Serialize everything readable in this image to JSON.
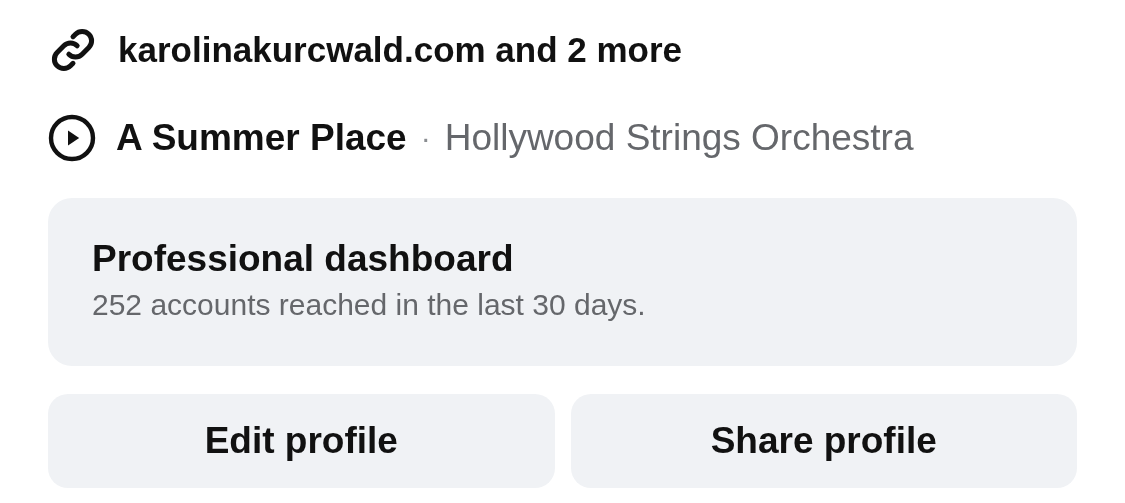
{
  "link": {
    "text": "karolinakurcwald.com and 2 more"
  },
  "music": {
    "title": "A Summer Place",
    "separator": "·",
    "artist": "Hollywood Strings Orchestra"
  },
  "dashboard": {
    "title": "Professional dashboard",
    "subtitle": "252 accounts reached in the last 30 days."
  },
  "buttons": [
    "Edit profile",
    "Share profile"
  ]
}
